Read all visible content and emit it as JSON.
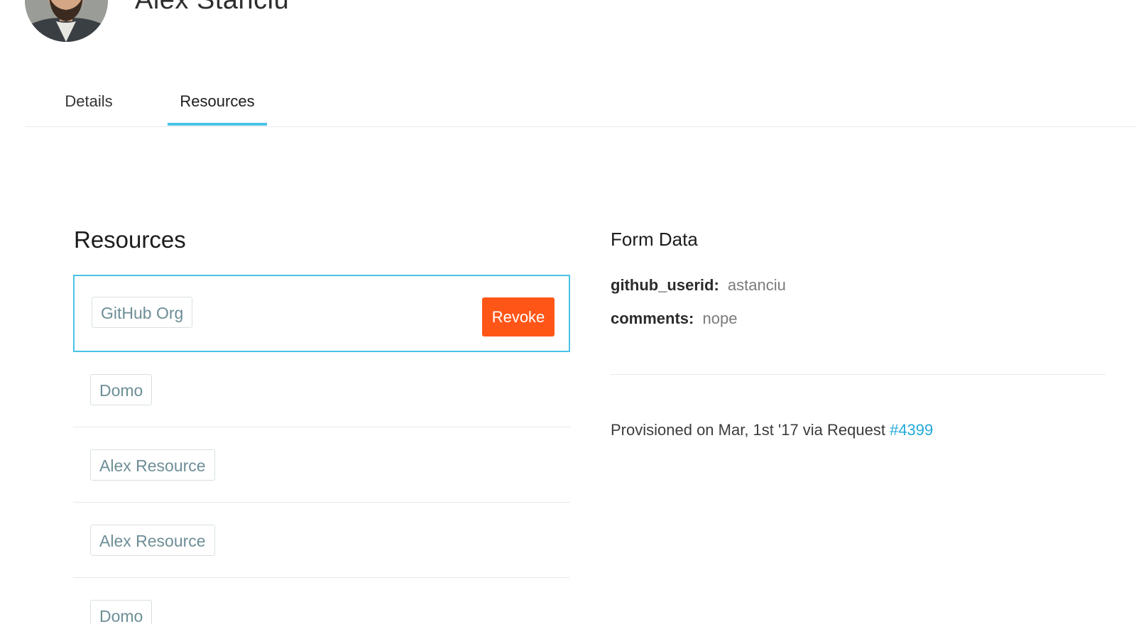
{
  "header": {
    "user_name": "Alex Stanciu"
  },
  "tabs": [
    {
      "label": "Details",
      "active": false
    },
    {
      "label": "Resources",
      "active": true
    }
  ],
  "resources": {
    "title": "Resources",
    "items": [
      {
        "label": "GitHub Org",
        "selected": true
      },
      {
        "label": "Domo",
        "selected": false
      },
      {
        "label": "Alex Resource",
        "selected": false
      },
      {
        "label": "Alex Resource",
        "selected": false
      },
      {
        "label": "Domo",
        "selected": false
      }
    ],
    "revoke_label": "Revoke"
  },
  "form_data": {
    "title": "Form Data",
    "fields": [
      {
        "key": "github_userid:",
        "value": "astanciu"
      },
      {
        "key": "comments:",
        "value": "nope"
      }
    ],
    "provisioned_text": "Provisioned on Mar, 1st '17 via Request ",
    "request_link": "#4399"
  },
  "colors": {
    "accent": "#4bc3e6",
    "revoke": "#ff5618",
    "link": "#23a9d9",
    "tag_text": "#6d8e96"
  }
}
